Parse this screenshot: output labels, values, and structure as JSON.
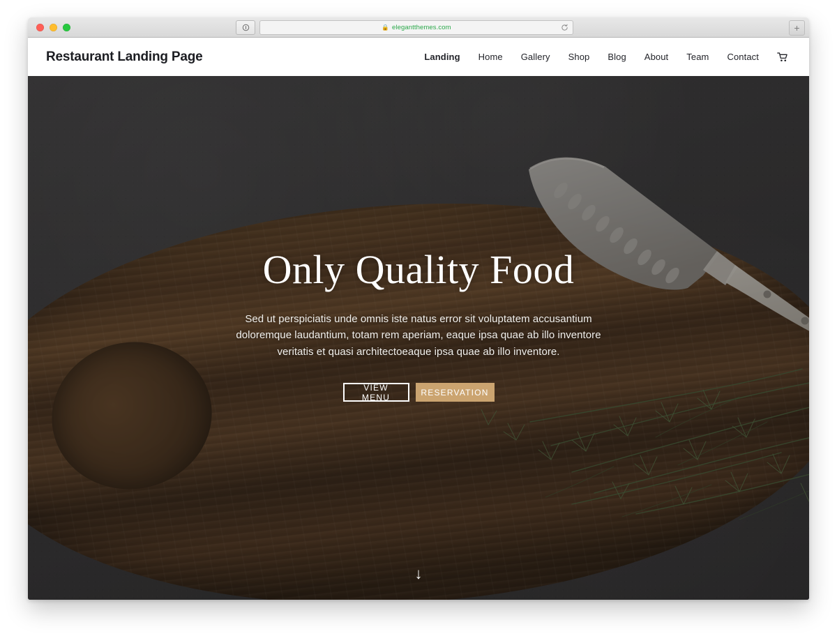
{
  "browser": {
    "url": "elegantthemes.com",
    "lock_icon": "lock-icon",
    "reload_icon": "reload-icon",
    "new_tab_icon": "plus-icon",
    "shield_icon": "shield-icon",
    "traffic_lights": [
      "close-red",
      "minimize-yellow",
      "maximize-green"
    ]
  },
  "site": {
    "logo": "Restaurant Landing Page",
    "nav": [
      {
        "label": "Landing",
        "active": true
      },
      {
        "label": "Home",
        "active": false
      },
      {
        "label": "Gallery",
        "active": false
      },
      {
        "label": "Shop",
        "active": false
      },
      {
        "label": "Blog",
        "active": false
      },
      {
        "label": "About",
        "active": false
      },
      {
        "label": "Team",
        "active": false
      },
      {
        "label": "Contact",
        "active": false
      }
    ],
    "cart_icon": "shopping-cart-icon"
  },
  "hero": {
    "title": "Only Quality Food",
    "paragraph": "Sed ut perspiciatis unde omnis iste natus error sit voluptatem accusantium doloremque laudantium, totam rem aperiam, eaque ipsa quae ab illo inventore veritatis et quasi architectoeaque ipsa quae ab illo inventore.",
    "primary_button": "VIEW MENU",
    "secondary_button": "RESERVATION",
    "scroll_indicator": "↓",
    "image_subject": "santoku knife and dill herbs on dark wooden cutting board over concrete"
  },
  "colors": {
    "accent_gold": "#cba470",
    "text_dark": "#1c1d22",
    "hero_text": "#ffffff",
    "secure_green": "#2ba84a",
    "page_background": "#ffffff"
  }
}
